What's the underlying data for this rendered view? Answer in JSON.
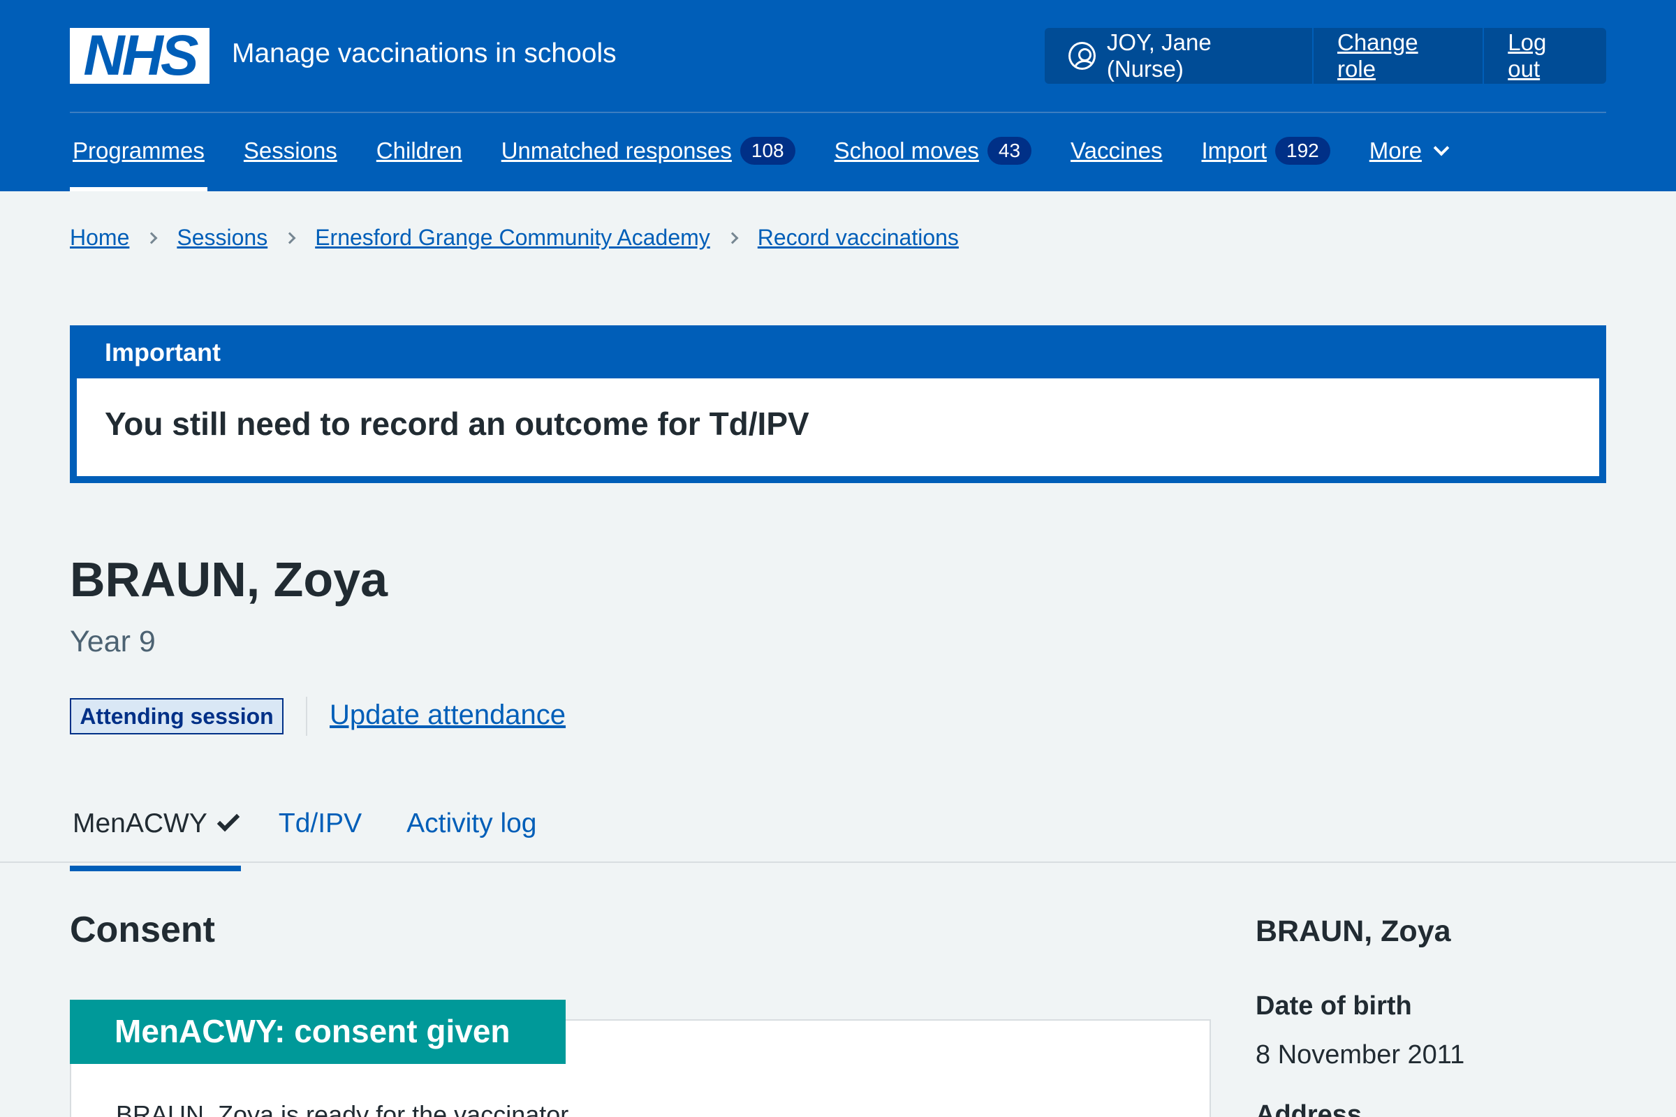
{
  "header": {
    "logo_text": "NHS",
    "service_name": "Manage vaccinations in schools",
    "account": {
      "user": "JOY, Jane (Nurse)",
      "change_role": "Change role",
      "log_out": "Log out"
    },
    "nav": [
      {
        "label": "Programmes",
        "active": true
      },
      {
        "label": "Sessions"
      },
      {
        "label": "Children"
      },
      {
        "label": "Unmatched responses",
        "count": "108"
      },
      {
        "label": "School moves",
        "count": "43"
      },
      {
        "label": "Vaccines"
      },
      {
        "label": "Import",
        "count": "192"
      },
      {
        "label": "More"
      }
    ]
  },
  "breadcrumb": [
    "Home",
    "Sessions",
    "Ernesford Grange Community Academy",
    "Record vaccinations"
  ],
  "callout": {
    "heading": "Important",
    "body": "You still need to record an outcome for Td/IPV"
  },
  "patient": {
    "name": "BRAUN, Zoya",
    "year": "Year 9",
    "attendance_tag": "Attending session",
    "update_attendance": "Update attendance"
  },
  "tabs": [
    {
      "label": "MenACWY",
      "active": true,
      "icon": "check-icon"
    },
    {
      "label": "Td/IPV"
    },
    {
      "label": "Activity log"
    }
  ],
  "consent": {
    "heading": "Consent",
    "card_heading": "MenACWY: consent given",
    "card_text": "BRAUN, Zoya is ready for the vaccinator"
  },
  "summary": {
    "name": "BRAUN, Zoya",
    "dob_label": "Date of birth",
    "dob_value": "8 November 2011",
    "address_label": "Address"
  },
  "colors": {
    "brand_blue": "#005eb8",
    "dark_blue": "#003087",
    "consent_green": "#009999",
    "page_bg": "#f0f4f5"
  }
}
